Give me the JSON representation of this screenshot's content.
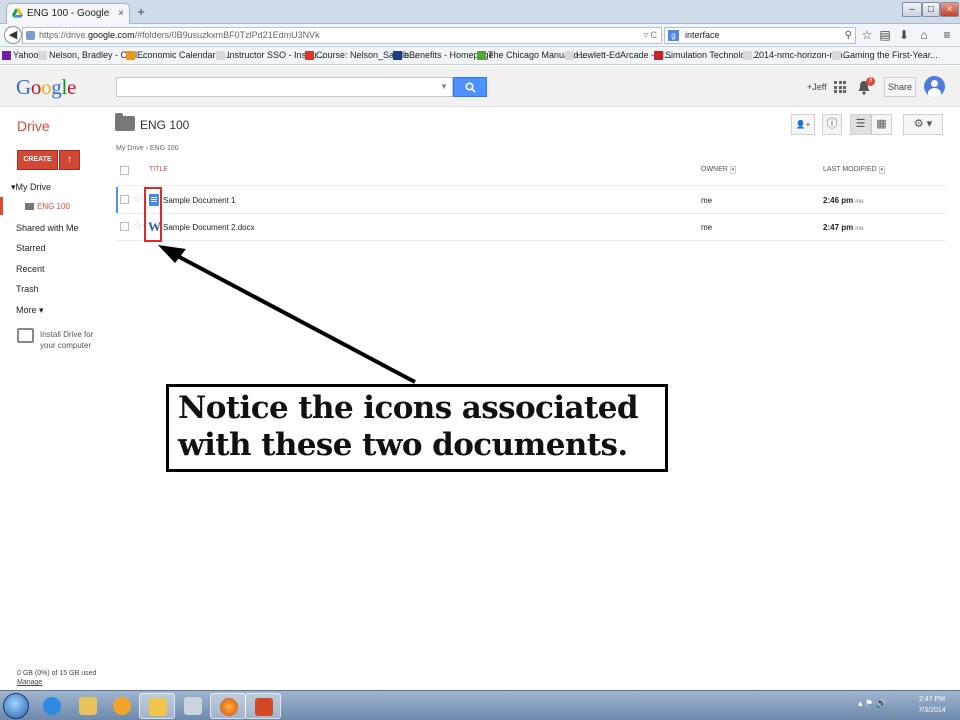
{
  "browser": {
    "tab_title": "ENG 100 - Google Drive",
    "tab_close": "×",
    "new_tab": "+",
    "url_prefix": "https://drive.",
    "url_domain": "google.com",
    "url_rest": "/#folders/0B9usuzkxmBF0TzlPd21EdmU3NVk",
    "search_query": "interface",
    "window_min": "–",
    "window_max": "□",
    "window_close": "×"
  },
  "bookmarks": [
    {
      "label": "Yahoo",
      "icon_color": "#6f1fa8"
    },
    {
      "label": "Nelson, Bradley - Outl...",
      "icon_color": "#d8d8d8"
    },
    {
      "label": "Economic Calendar - ...",
      "icon_color": "#e99a1c"
    },
    {
      "label": "Instructor SSO - Instru...",
      "icon_color": "#d8d8d8"
    },
    {
      "label": "Course: Nelson_Sandb...",
      "icon_color": "#d83a2a"
    },
    {
      "label": "eBenefits - Homepage",
      "icon_color": "#1c3f8a"
    },
    {
      "label": "The Chicago Manual o...",
      "icon_color": "#56a33a"
    },
    {
      "label": "Hewlett-EdArcade - M...",
      "icon_color": "#d8d8d8"
    },
    {
      "label": "Simulation Technologi...",
      "icon_color": "#c4262e"
    },
    {
      "label": "2014-nmc-horizon-rep...",
      "icon_color": "#d8d8d8"
    },
    {
      "label": "Gaming the First-Year...",
      "icon_color": "#d8d8d8"
    }
  ],
  "header": {
    "logo_letters": [
      "G",
      "o",
      "o",
      "g",
      "l",
      "e"
    ],
    "search_button": "🔍",
    "plus_user": "+Jeff",
    "notification_count": "3",
    "share_label": "Share"
  },
  "drive": {
    "title": "Drive",
    "folder_title": "ENG 100",
    "breadcrumb_root": "My Drive",
    "breadcrumb_sep": "›",
    "breadcrumb_current": "ENG 100",
    "create_label": "CREATE",
    "upload_icon": "↑",
    "toolbar_icons": {
      "add_person": "👤+",
      "info": "ⓘ",
      "list": "☰",
      "grid": "▦",
      "settings": "⚙ ▾"
    }
  },
  "sidebar": {
    "my_drive": "▾My Drive",
    "eng_folder": "ENG 100",
    "shared": "Shared with Me",
    "starred": "Starred",
    "recent": "Recent",
    "trash": "Trash",
    "more": "More ▾",
    "install": "Install Drive for your computer",
    "storage": "0 GB (0%) of 15 GB used",
    "manage": "Manage"
  },
  "file_list": {
    "columns": {
      "title": "TITLE",
      "owner": "OWNER",
      "modified": "LAST MODIFIED"
    },
    "rows": [
      {
        "name": "Sample Document 1",
        "owner": "me",
        "modified": "2:46 pm",
        "modified_by": "me",
        "icon": "google-docs-icon"
      },
      {
        "name": "Sample Document 2.docx",
        "owner": "me",
        "modified": "2:47 pm",
        "modified_by": "me",
        "icon": "word-icon"
      }
    ]
  },
  "callout": {
    "text": "Notice the icons associated with these two documents."
  },
  "taskbar": {
    "clock_time": "2:47 PM",
    "clock_date": "7/3/2014",
    "tray_icons": "▴ ⚑ 🔊"
  },
  "colors": {
    "drive_red": "#dd4b39",
    "search_blue": "#4d90fe",
    "highlight_red": "#e32626"
  }
}
